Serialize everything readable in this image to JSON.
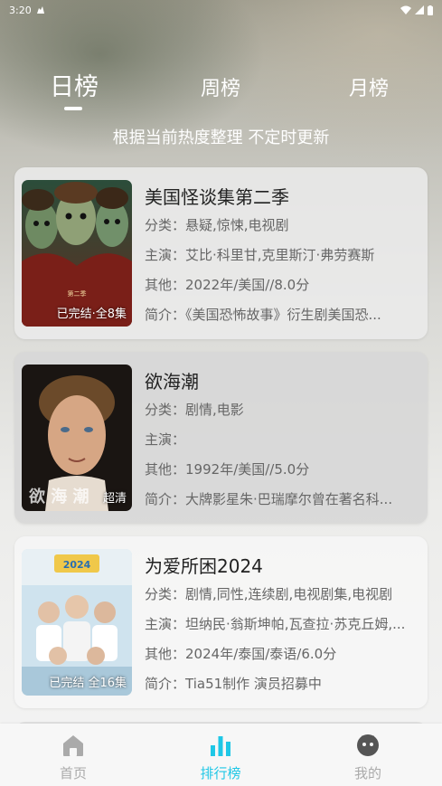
{
  "status_bar": {
    "time": "3:20"
  },
  "tabs": [
    {
      "label": "日榜",
      "active": true
    },
    {
      "label": "周榜",
      "active": false
    },
    {
      "label": "月榜",
      "active": false
    }
  ],
  "subtitle": "根据当前热度整理 不定时更新",
  "items": [
    {
      "title": "美国怪谈集第二季",
      "category_label": "分类：",
      "category": "悬疑,惊悚,电视剧",
      "cast_label": "主演：",
      "cast": "艾比·科里甘,克里斯汀·弗劳赛斯",
      "other_label": "其他：",
      "other": "2022年/美国//8.0分",
      "intro_label": "简介：",
      "intro": "《美国恐怖故事》衍生剧美国恐...",
      "poster_tag": "已完结·全8集",
      "poster_art_text": "第二季"
    },
    {
      "title": "欲海潮",
      "category_label": "分类：",
      "category": "剧情,电影",
      "cast_label": "主演：",
      "cast": "",
      "other_label": "其他：",
      "other": "1992年/美国//5.0分",
      "intro_label": "简介：",
      "intro": "大牌影星朱·巴瑞摩尔曾在著名科...",
      "poster_tag": "超清",
      "poster_art_text": "欲 海 潮"
    },
    {
      "title": "为爱所困2024",
      "category_label": "分类：",
      "category": "剧情,同性,连续剧,电视剧集,电视剧",
      "cast_label": "主演：",
      "cast": "坦纳民·翁斯坤帕,瓦查拉·苏克丘姆,...",
      "other_label": "其他：",
      "other": "2024年/泰国/泰语/6.0分",
      "intro_label": "简介：",
      "intro": "Tia51制作 演员招募中",
      "poster_tag": "已完结 全16集",
      "poster_art_text": "2024"
    }
  ],
  "nav": [
    {
      "label": "首页",
      "icon": "home-icon",
      "active": false
    },
    {
      "label": "排行榜",
      "icon": "ranking-icon",
      "active": true
    },
    {
      "label": "我的",
      "icon": "profile-icon",
      "active": false
    }
  ],
  "colors": {
    "accent": "#1fc7e6",
    "inactive_nav": "#aaaaaa"
  }
}
